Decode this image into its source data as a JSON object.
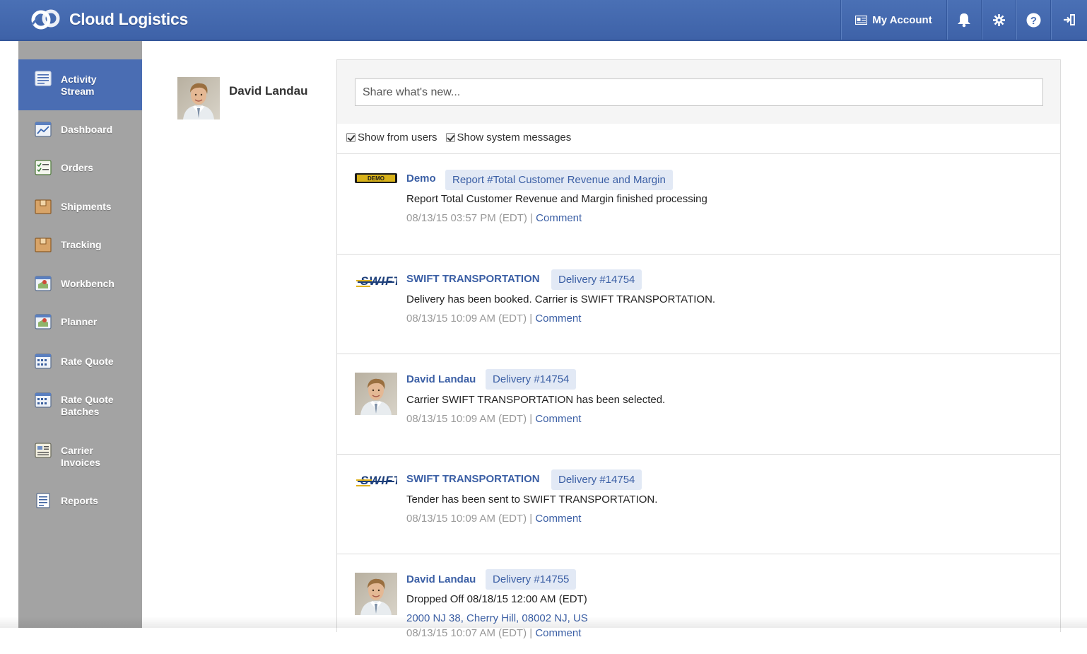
{
  "header": {
    "brand": "Cloud Logistics",
    "account_label": "My Account",
    "icons": [
      "bell-icon",
      "gear-icon",
      "help-icon",
      "logout-icon"
    ],
    "color": "#4a70b5"
  },
  "sidebar": {
    "items": [
      {
        "label": "Activity\nStream",
        "icon": "activity-stream-icon",
        "active": true
      },
      {
        "label": "Dashboard",
        "icon": "dashboard-icon"
      },
      {
        "label": "Orders",
        "icon": "orders-icon"
      },
      {
        "label": "Shipments",
        "icon": "shipments-icon"
      },
      {
        "label": "Tracking",
        "icon": "tracking-icon"
      },
      {
        "label": "Workbench",
        "icon": "workbench-icon"
      },
      {
        "label": "Planner",
        "icon": "planner-icon"
      },
      {
        "label": "Rate Quote",
        "icon": "rate-quote-icon"
      },
      {
        "label": "Rate Quote\nBatches",
        "icon": "rate-quote-batches-icon"
      },
      {
        "label": "Carrier\nInvoices",
        "icon": "carrier-invoices-icon"
      },
      {
        "label": "Reports",
        "icon": "reports-icon"
      }
    ]
  },
  "profile": {
    "name": "David Landau"
  },
  "share": {
    "placeholder": "Share what's new..."
  },
  "filters": {
    "users_label": "Show from users",
    "system_label": "Show system messages"
  },
  "entries": [
    {
      "author": "Demo",
      "tag": "Report #Total Customer Revenue and Margin",
      "message": "Report Total Customer Revenue and Margin finished processing",
      "time": "08/13/15 03:57 PM (EDT)",
      "comment": "Comment"
    },
    {
      "author": "SWIFT TRANSPORTATION",
      "tag": "Delivery #14754",
      "message": "Delivery has been booked. Carrier is SWIFT TRANSPORTATION.",
      "time": "08/13/15 10:09 AM (EDT)",
      "comment": "Comment"
    },
    {
      "author": "David Landau",
      "tag": "Delivery #14754",
      "message": "Carrier SWIFT TRANSPORTATION has been selected.",
      "time": "08/13/15 10:09 AM (EDT)",
      "comment": "Comment"
    },
    {
      "author": "SWIFT TRANSPORTATION",
      "tag": "Delivery #14754",
      "message": "Tender has been sent to SWIFT TRANSPORTATION.",
      "time": "08/13/15 10:09 AM (EDT)",
      "comment": "Comment"
    },
    {
      "author": "David Landau",
      "tag": "Delivery #14755",
      "message": "Dropped Off 08/18/15 12:00 AM (EDT)",
      "link": "2000 NJ 38, Cherry Hill, 08002 NJ, US",
      "time": "08/13/15 10:07 AM (EDT)",
      "comment": "Comment"
    }
  ],
  "separator": "|"
}
